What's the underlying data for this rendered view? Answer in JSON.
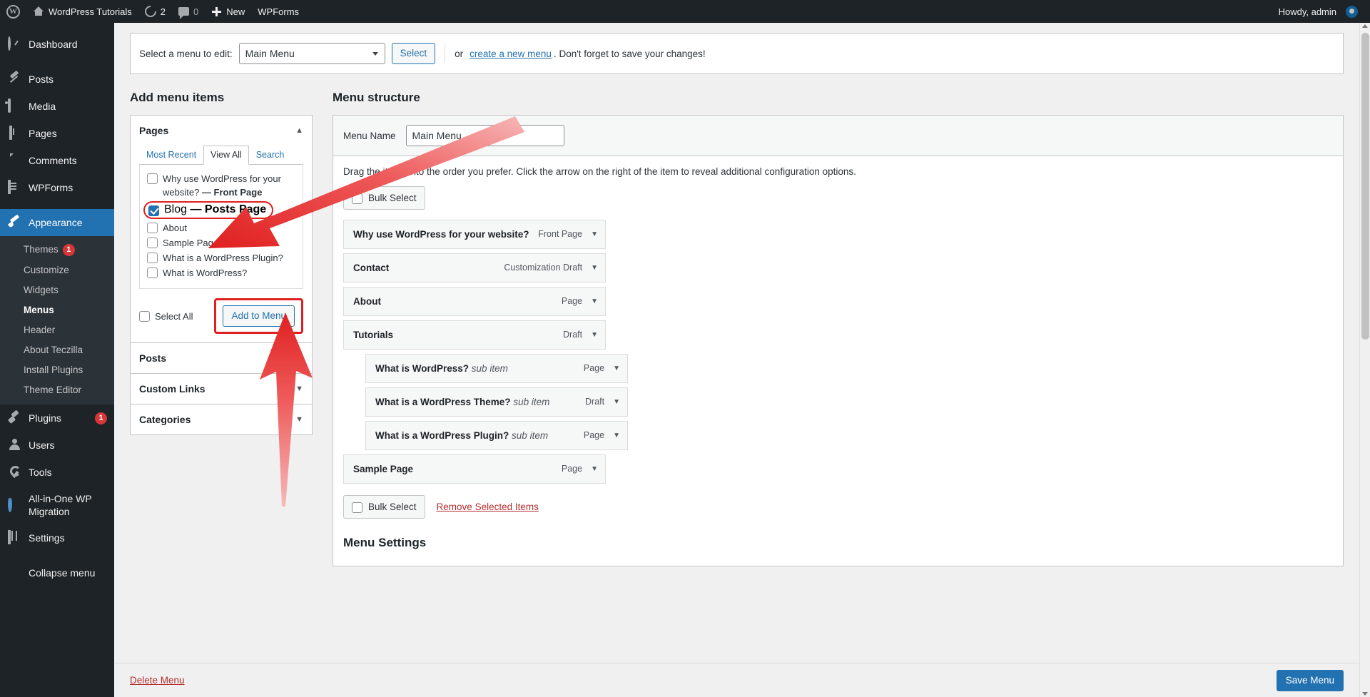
{
  "adminbar": {
    "logo_icon": "wordpress-logo-icon",
    "site_name": "WordPress Tutorials",
    "home_icon": "home-icon",
    "updates_icon": "updates-refresh-icon",
    "updates_count": "2",
    "comments_icon": "comment-bubble-icon",
    "comments_count": "0",
    "new_icon": "plus-icon",
    "new_label": "New",
    "wpforms_label": "WPForms",
    "howdy": "Howdy, admin",
    "avatar_icon": "user-avatar-icon"
  },
  "sidebar": {
    "items": [
      {
        "label": "Dashboard",
        "icon": "dashboard-icon",
        "badge": ""
      },
      {
        "label": "Posts",
        "icon": "pin-icon",
        "badge": ""
      },
      {
        "label": "Media",
        "icon": "media-icon",
        "badge": ""
      },
      {
        "label": "Pages",
        "icon": "pages-icon",
        "badge": ""
      },
      {
        "label": "Comments",
        "icon": "comments-icon",
        "badge": ""
      },
      {
        "label": "WPForms",
        "icon": "wpforms-icon",
        "badge": ""
      },
      {
        "label": "Appearance",
        "icon": "appearance-brush-icon",
        "badge": ""
      },
      {
        "label": "Plugins",
        "icon": "plugin-icon",
        "badge": "1"
      },
      {
        "label": "Users",
        "icon": "users-icon",
        "badge": ""
      },
      {
        "label": "Tools",
        "icon": "tools-wrench-icon",
        "badge": ""
      },
      {
        "label": "All-in-One WP Migration",
        "icon": "migration-icon",
        "badge": ""
      },
      {
        "label": "Settings",
        "icon": "settings-sliders-icon",
        "badge": ""
      },
      {
        "label": "Collapse menu",
        "icon": "collapse-arrow-icon",
        "badge": ""
      }
    ],
    "appearance_submenu": [
      {
        "label": "Themes",
        "badge": "1",
        "active": false
      },
      {
        "label": "Customize",
        "badge": "",
        "active": false
      },
      {
        "label": "Widgets",
        "badge": "",
        "active": false
      },
      {
        "label": "Menus",
        "badge": "",
        "active": true
      },
      {
        "label": "Header",
        "badge": "",
        "active": false
      },
      {
        "label": "About Teczilla",
        "badge": "",
        "active": false
      },
      {
        "label": "Install Plugins",
        "badge": "",
        "active": false
      },
      {
        "label": "Theme Editor",
        "badge": "",
        "active": false
      }
    ]
  },
  "menu_select_bar": {
    "label": "Select a menu to edit:",
    "selected_menu": "Main Menu",
    "options": [
      "Main Menu"
    ],
    "select_button": "Select",
    "or_text": "or",
    "create_link": "create a new menu",
    "tail_text": ". Don't forget to save your changes!"
  },
  "add_menu_items": {
    "title": "Add menu items",
    "panels": [
      {
        "name": "Pages",
        "expanded": true,
        "caret": "caret-up-icon"
      },
      {
        "name": "Posts",
        "expanded": false,
        "caret": "caret-down-icon"
      },
      {
        "name": "Custom Links",
        "expanded": false,
        "caret": "caret-down-icon"
      },
      {
        "name": "Categories",
        "expanded": false,
        "caret": "caret-down-icon"
      }
    ],
    "tabs": [
      {
        "label": "Most Recent",
        "active": false
      },
      {
        "label": "View All",
        "active": true
      },
      {
        "label": "Search",
        "active": false
      }
    ],
    "page_items": [
      {
        "label": "Why use WordPress for your website?",
        "suffix": " — Front Page",
        "checked": false,
        "highlighted": false
      },
      {
        "label": "Blog",
        "suffix": " — Posts Page",
        "checked": true,
        "highlighted": true
      },
      {
        "label": "About",
        "suffix": "",
        "checked": false,
        "highlighted": false
      },
      {
        "label": "Sample Page",
        "suffix": "",
        "checked": false,
        "highlighted": false
      },
      {
        "label": "What is a WordPress Plugin?",
        "suffix": "",
        "checked": false,
        "highlighted": false
      },
      {
        "label": "What is WordPress?",
        "suffix": "",
        "checked": false,
        "highlighted": false
      }
    ],
    "select_all_label": "Select All",
    "add_to_menu_label": "Add to Menu"
  },
  "menu_structure": {
    "title": "Menu structure",
    "name_label": "Menu Name",
    "name_value": "Main Menu",
    "name_placeholder": "Menu Name",
    "hint": "Drag the items into the order you prefer. Click the arrow on the right of the item to reveal additional configuration options.",
    "bulk_select_top": "Bulk Select",
    "bulk_select_bottom": "Bulk Select",
    "remove_selected": "Remove Selected Items",
    "items": [
      {
        "title": "Why use WordPress for your website?",
        "sub": "",
        "type": "Front Page",
        "depth": 0,
        "arrow": "caret-down-icon"
      },
      {
        "title": "Contact",
        "sub": "",
        "type": "Customization Draft",
        "depth": 0,
        "arrow": "caret-down-icon"
      },
      {
        "title": "About",
        "sub": "",
        "type": "Page",
        "depth": 0,
        "arrow": "caret-down-icon"
      },
      {
        "title": "Tutorials",
        "sub": "",
        "type": "Draft",
        "depth": 0,
        "arrow": "caret-down-icon"
      },
      {
        "title": "What is WordPress?",
        "sub": "sub item",
        "type": "Page",
        "depth": 1,
        "arrow": "caret-down-icon"
      },
      {
        "title": "What is a WordPress Theme?",
        "sub": "sub item",
        "type": "Draft",
        "depth": 1,
        "arrow": "caret-down-icon"
      },
      {
        "title": "What is a WordPress Plugin?",
        "sub": "sub item",
        "type": "Page",
        "depth": 1,
        "arrow": "caret-down-icon"
      },
      {
        "title": "Sample Page",
        "sub": "",
        "type": "Page",
        "depth": 0,
        "arrow": "caret-down-icon"
      }
    ],
    "settings_title": "Menu Settings"
  },
  "footer": {
    "delete_menu": "Delete Menu",
    "save_menu": "Save Menu"
  },
  "colors": {
    "admin_dark": "#1d2327",
    "admin_darker": "#2c3338",
    "accent_blue": "#2271b1",
    "badge_red": "#d63638",
    "annotation_red": "#e02020",
    "link_red": "#b32d2e",
    "page_bg": "#f0f0f1"
  }
}
